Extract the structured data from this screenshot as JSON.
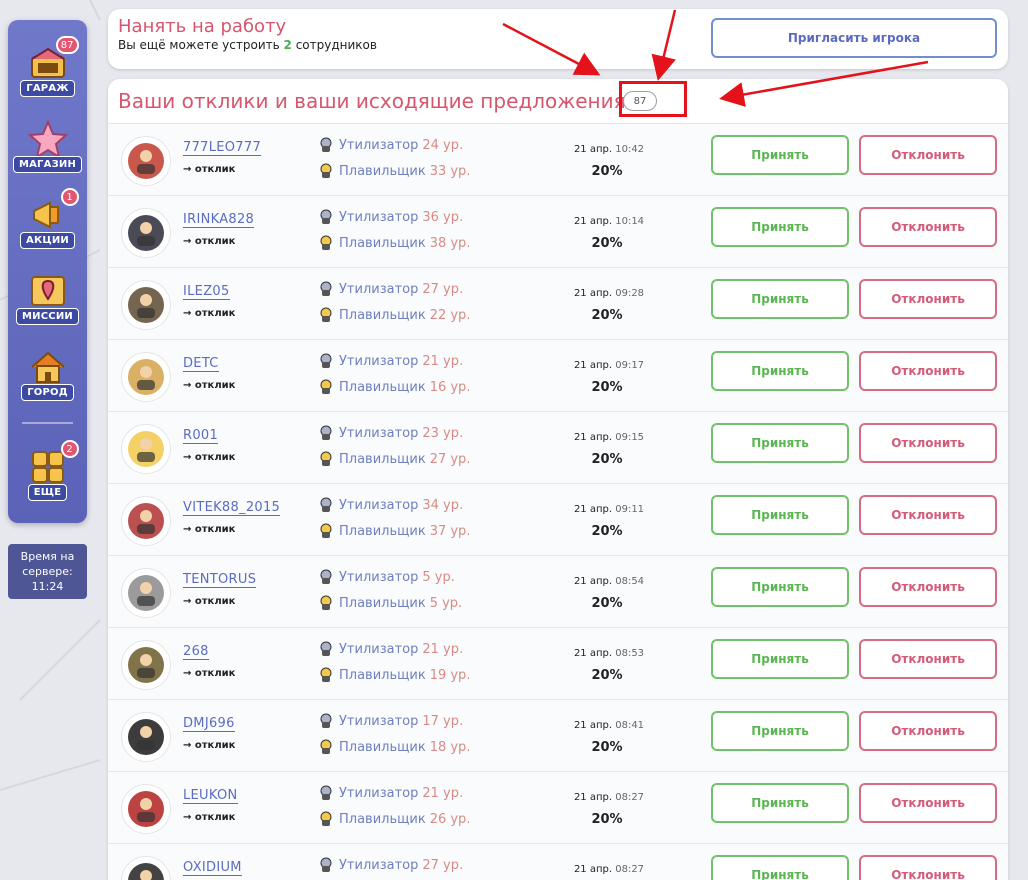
{
  "sidebar": {
    "items": [
      {
        "label": "ГАРАЖ",
        "badge": "87",
        "icon": "garage-icon",
        "color": "#e36a7a"
      },
      {
        "label": "МАГАЗИН",
        "badge": "",
        "icon": "star-icon",
        "color": "#f3b4c4"
      },
      {
        "label": "АКЦИИ",
        "badge": "1",
        "icon": "megaphone-icon",
        "color": "#f0c040"
      },
      {
        "label": "МИССИИ",
        "badge": "",
        "icon": "map-pin-icon",
        "color": "#f0b040"
      },
      {
        "label": "ГОРОД",
        "badge": "",
        "icon": "house-icon",
        "color": "#f0b040"
      },
      {
        "label": "ЕЩЕ",
        "badge": "2",
        "icon": "grid-icon",
        "color": "#f0a020"
      }
    ],
    "server_time_label": "Время на сервере:",
    "server_time": "11:24"
  },
  "hire": {
    "title": "Нанять на работу",
    "sub_prefix": "Вы ещё можете устроить ",
    "sub_count": "2",
    "sub_suffix": " сотрудников",
    "invite_label": "Пригласить игрока"
  },
  "list": {
    "title": "Ваши отклики и ваши исходящие предложения",
    "count": "87",
    "reply_label": "→ отклик",
    "job1_name": "Утилизатор",
    "job2_name": "Плавильщик",
    "accept_label": "Принять",
    "decline_label": "Отклонить",
    "rows": [
      {
        "name": "777LEO777",
        "j1": "24 ур.",
        "j2": "33 ур.",
        "date": "21 апр.",
        "time": "10:42",
        "pct": "20%"
      },
      {
        "name": "IRINKA828",
        "j1": "36 ур.",
        "j2": "38 ур.",
        "date": "21 апр.",
        "time": "10:14",
        "pct": "20%"
      },
      {
        "name": "ILEZ05",
        "j1": "27 ур.",
        "j2": "22 ур.",
        "date": "21 апр.",
        "time": "09:28",
        "pct": "20%"
      },
      {
        "name": "DETC",
        "j1": "21 ур.",
        "j2": "16 ур.",
        "date": "21 апр.",
        "time": "09:17",
        "pct": "20%"
      },
      {
        "name": "R001",
        "j1": "23 ур.",
        "j2": "27 ур.",
        "date": "21 апр.",
        "time": "09:15",
        "pct": "20%"
      },
      {
        "name": "VITEK88_2015",
        "j1": "34 ур.",
        "j2": "37 ур.",
        "date": "21 апр.",
        "time": "09:11",
        "pct": "20%"
      },
      {
        "name": "TENTORUS",
        "j1": "5 ур.",
        "j2": "5 ур.",
        "date": "21 апр.",
        "time": "08:54",
        "pct": "20%"
      },
      {
        "name": "268",
        "j1": "21 ур.",
        "j2": "19 ур.",
        "date": "21 апр.",
        "time": "08:53",
        "pct": "20%"
      },
      {
        "name": "DMJ696",
        "j1": "17 ур.",
        "j2": "18 ур.",
        "date": "21 апр.",
        "time": "08:41",
        "pct": "20%"
      },
      {
        "name": "LEUKON",
        "j1": "21 ур.",
        "j2": "26 ур.",
        "date": "21 апр.",
        "time": "08:27",
        "pct": "20%"
      },
      {
        "name": "OXIDIUM",
        "j1": "27 ур.",
        "j2": "",
        "date": "21 апр.",
        "time": "08:27",
        "pct": ""
      }
    ],
    "avatar_colors": [
      "#c0392b",
      "#2c2c3a",
      "#5a4a30",
      "#d4a24a",
      "#f2c94c",
      "#b03030",
      "#8a8a8a",
      "#6b5a2a",
      "#1a1a1a",
      "#b22222",
      "#222222"
    ]
  },
  "colors": {
    "accent_red": "#d7566d",
    "link_blue": "#5b6cc0",
    "accept_green": "#72c26b",
    "decline_pink": "#d66c84",
    "annotation_red": "#e3121b"
  }
}
